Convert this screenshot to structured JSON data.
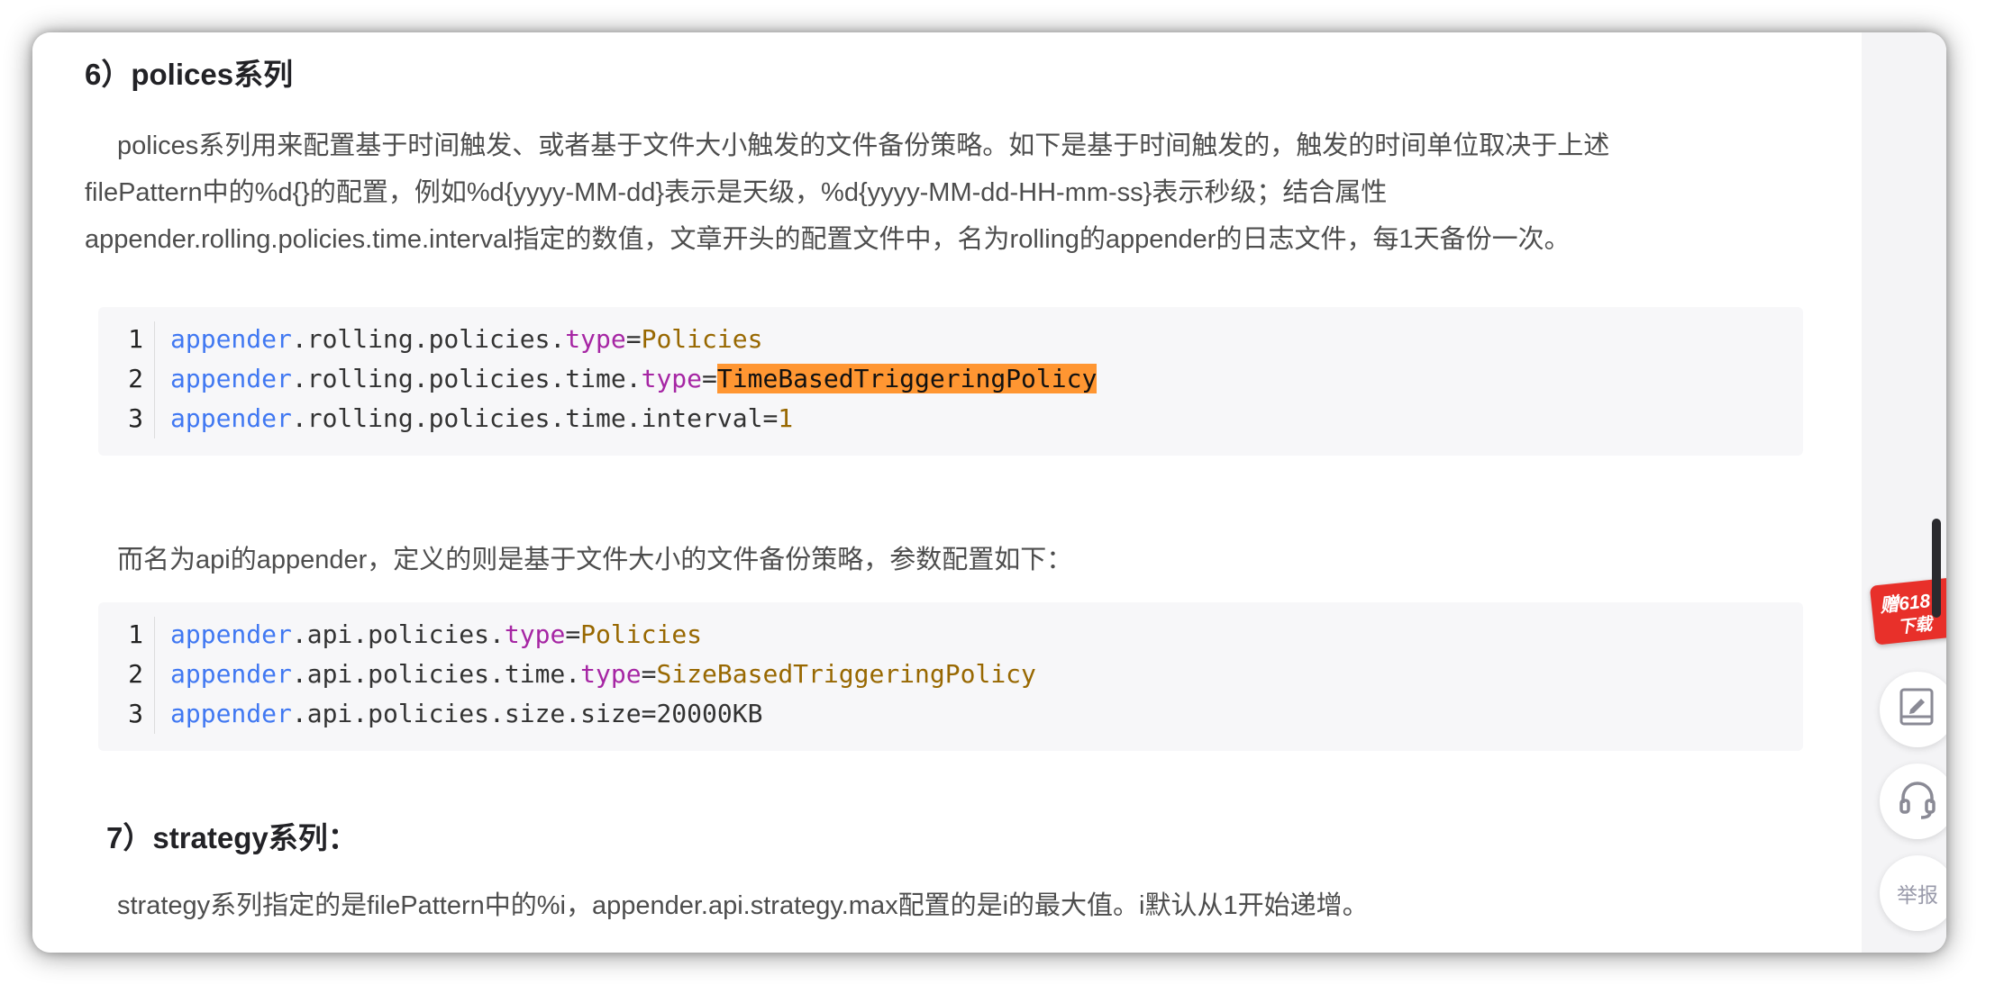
{
  "article": {
    "heading6": "6）polices系列",
    "para1": [
      "polices系列用来配置基于时间触发、或者基于文件大小触发的文件备份策略。如下是基于时间触发的，触发的时间单位取决于上述",
      "filePattern中的%d{}的配置，例如%d{yyyy-MM-dd}表示是天级，%d{yyyy-MM-dd-HH-mm-ss}表示秒级；结合属性",
      "appender.rolling.policies.time.interval指定的数值，文章开头的配置文件中，名为rolling的appender的日志文件，每1天备份一次。"
    ],
    "code1": [
      {
        "num": "1",
        "p1": "appender",
        "p2": ".rolling.policies.",
        "p3": "type",
        "p4": "=",
        "p5": "Policies",
        "p6": ""
      },
      {
        "num": "2",
        "p1": "appender",
        "p2": ".rolling.policies.time.",
        "p3": "type",
        "p4": "=",
        "p5": "",
        "p6": "TimeBasedTriggeringPolicy"
      },
      {
        "num": "3",
        "p1": "appender",
        "p2": ".rolling.policies.time.interval=",
        "p3": "",
        "p4": "",
        "p5": "1",
        "p6": ""
      }
    ],
    "para2": "而名为api的appender，定义的则是基于文件大小的文件备份策略，参数配置如下：",
    "code2": [
      {
        "num": "1",
        "p1": "appender",
        "p2": ".api.policies.",
        "p3": "type",
        "p4": "=",
        "p5": "Policies"
      },
      {
        "num": "2",
        "p1": "appender",
        "p2": ".api.policies.time.",
        "p3": "type",
        "p4": "=",
        "p5": "SizeBasedTriggeringPolicy"
      },
      {
        "num": "3",
        "p1": "appender",
        "p2": ".api.policies.size.size=20000KB",
        "p3": "",
        "p4": "",
        "p5": ""
      }
    ],
    "heading7": "7）strategy系列：",
    "para3": "strategy系列指定的是filePattern中的%i，appender.api.strategy.max配置的是i的最大值。i默认从1开始递增。"
  },
  "sidebar": {
    "promo_line1": "赠618",
    "promo_line2": "下载",
    "report_label": "举报",
    "icons": [
      "edit-icon",
      "headset-icon"
    ]
  },
  "colors": {
    "code_bg": "#f7f7f9",
    "keyword_blue": "#4078f2",
    "keyword_purple": "#a626a4",
    "value_brown": "#986801",
    "highlight": "#ff9632",
    "promo_red": "#e8302a"
  }
}
